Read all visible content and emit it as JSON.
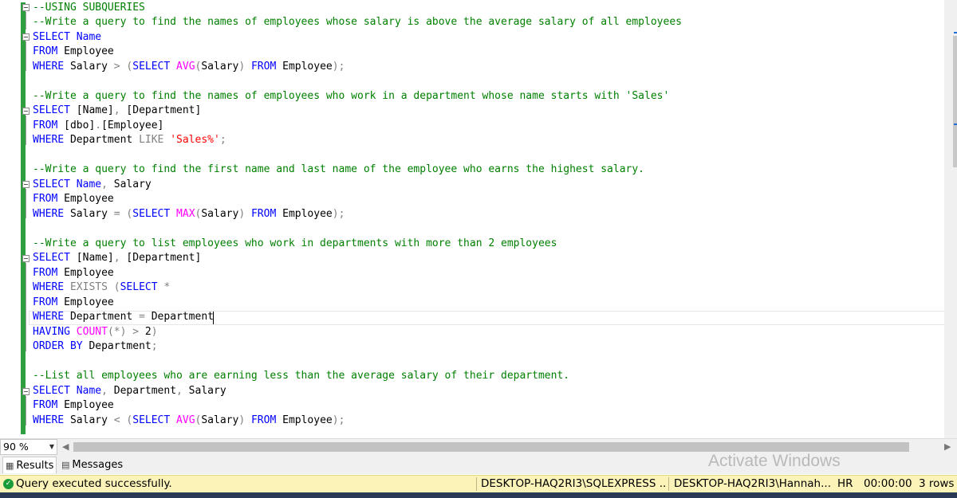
{
  "editor": {
    "lines": [
      [
        [
          "cm",
          "--USING SUBQUERIES"
        ]
      ],
      [
        [
          "cm",
          "--Write a query to find the names of employees whose salary is above the average salary of all employees"
        ]
      ],
      [
        [
          "kw",
          "SELECT"
        ],
        [
          "",
          " "
        ],
        [
          "kw",
          "Name"
        ]
      ],
      [
        [
          "kw",
          "FROM"
        ],
        [
          "",
          " Employee"
        ]
      ],
      [
        [
          "kw",
          "WHERE"
        ],
        [
          "",
          " Salary "
        ],
        [
          "gr",
          ">"
        ],
        [
          "",
          " "
        ],
        [
          "gr",
          "("
        ],
        [
          "kw",
          "SELECT"
        ],
        [
          "",
          " "
        ],
        [
          "fn",
          "AVG"
        ],
        [
          "gr",
          "("
        ],
        [
          "",
          "Salary"
        ],
        [
          "gr",
          ")"
        ],
        [
          "",
          " "
        ],
        [
          "kw",
          "FROM"
        ],
        [
          "",
          " Employee"
        ],
        [
          "gr",
          ");"
        ]
      ],
      [],
      [
        [
          "cm",
          "--Write a query to find the names of employees who work in a department whose name starts with 'Sales'"
        ]
      ],
      [
        [
          "kw",
          "SELECT"
        ],
        [
          "",
          " [Name]"
        ],
        [
          "gr",
          ","
        ],
        [
          "",
          " [Department]"
        ]
      ],
      [
        [
          "kw",
          "FROM"
        ],
        [
          "",
          " [dbo]"
        ],
        [
          "gr",
          "."
        ],
        [
          "",
          "[Employee]"
        ]
      ],
      [
        [
          "kw",
          "WHERE"
        ],
        [
          "",
          " Department "
        ],
        [
          "gr",
          "LIKE"
        ],
        [
          "",
          " "
        ],
        [
          "st",
          "'Sales%'"
        ],
        [
          "gr",
          ";"
        ]
      ],
      [],
      [
        [
          "cm",
          "--Write a query to find the first name and last name of the employee who earns the highest salary."
        ]
      ],
      [
        [
          "kw",
          "SELECT"
        ],
        [
          "",
          " "
        ],
        [
          "kw",
          "Name"
        ],
        [
          "gr",
          ","
        ],
        [
          "",
          " Salary"
        ]
      ],
      [
        [
          "kw",
          "FROM"
        ],
        [
          "",
          " Employee"
        ]
      ],
      [
        [
          "kw",
          "WHERE"
        ],
        [
          "",
          " Salary "
        ],
        [
          "gr",
          "="
        ],
        [
          "",
          " "
        ],
        [
          "gr",
          "("
        ],
        [
          "kw",
          "SELECT"
        ],
        [
          "",
          " "
        ],
        [
          "fn",
          "MAX"
        ],
        [
          "gr",
          "("
        ],
        [
          "",
          "Salary"
        ],
        [
          "gr",
          ")"
        ],
        [
          "",
          " "
        ],
        [
          "kw",
          "FROM"
        ],
        [
          "",
          " Employee"
        ],
        [
          "gr",
          ");"
        ]
      ],
      [],
      [
        [
          "cm",
          "--Write a query to list employees who work in departments with more than 2 employees"
        ]
      ],
      [
        [
          "kw",
          "SELECT"
        ],
        [
          "",
          " [Name]"
        ],
        [
          "gr",
          ","
        ],
        [
          "",
          " [Department]"
        ]
      ],
      [
        [
          "kw",
          "FROM"
        ],
        [
          "",
          " Employee"
        ]
      ],
      [
        [
          "kw",
          "WHERE"
        ],
        [
          "",
          " "
        ],
        [
          "gr",
          "EXISTS"
        ],
        [
          "",
          " "
        ],
        [
          "gr",
          "("
        ],
        [
          "kw",
          "SELECT"
        ],
        [
          "",
          " "
        ],
        [
          "gr",
          "*"
        ]
      ],
      [
        [
          "kw",
          "FROM"
        ],
        [
          "",
          " Employee"
        ]
      ],
      [
        [
          "kw",
          "WHERE"
        ],
        [
          "",
          " Department "
        ],
        [
          "gr",
          "="
        ],
        [
          "",
          " Department"
        ]
      ],
      [
        [
          "kw",
          "HAVING"
        ],
        [
          "",
          " "
        ],
        [
          "fn",
          "COUNT"
        ],
        [
          "gr",
          "(*)"
        ],
        [
          "",
          " "
        ],
        [
          "gr",
          ">"
        ],
        [
          "",
          " 2"
        ],
        [
          "gr",
          ")"
        ]
      ],
      [
        [
          "kw",
          "ORDER BY"
        ],
        [
          "",
          " Department"
        ],
        [
          "gr",
          ";"
        ]
      ],
      [],
      [
        [
          "cm",
          "--List all employees who are earning less than the average salary of their department."
        ]
      ],
      [
        [
          "kw",
          "SELECT"
        ],
        [
          "",
          " "
        ],
        [
          "kw",
          "Name"
        ],
        [
          "gr",
          ","
        ],
        [
          "",
          " Department"
        ],
        [
          "gr",
          ","
        ],
        [
          "",
          " Salary"
        ]
      ],
      [
        [
          "kw",
          "FROM"
        ],
        [
          "",
          " Employee"
        ]
      ],
      [
        [
          "kw",
          "WHERE"
        ],
        [
          "",
          " Salary "
        ],
        [
          "gr",
          "<"
        ],
        [
          "",
          " "
        ],
        [
          "gr",
          "("
        ],
        [
          "kw",
          "SELECT"
        ],
        [
          "",
          " "
        ],
        [
          "fn",
          "AVG"
        ],
        [
          "gr",
          "("
        ],
        [
          "",
          "Salary"
        ],
        [
          "gr",
          ")"
        ],
        [
          "",
          " "
        ],
        [
          "kw",
          "FROM"
        ],
        [
          "",
          " Employee"
        ],
        [
          "gr",
          ");"
        ]
      ]
    ]
  },
  "zoom": {
    "value": "90 %"
  },
  "tabs": {
    "results": "Results",
    "messages": "Messages"
  },
  "watermark": {
    "title": "Activate Windows"
  },
  "status": {
    "message": "Query executed successfully.",
    "server": "DESKTOP-HAQ2RI3\\SQLEXPRESS ...",
    "user": "DESKTOP-HAQ2RI3\\Hannah...",
    "database": "HR",
    "elapsed": "00:00:00",
    "rows": "3 rows"
  }
}
